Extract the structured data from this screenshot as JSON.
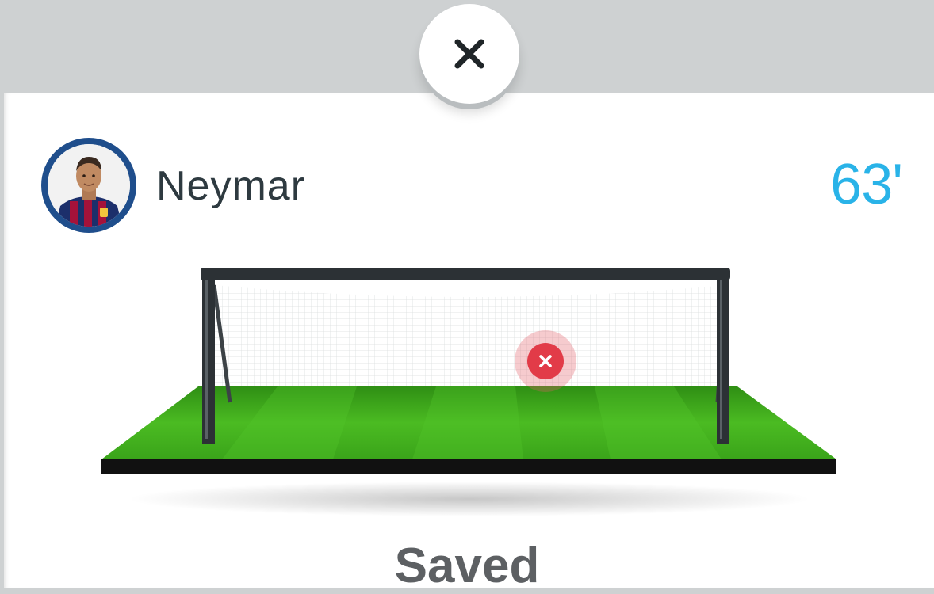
{
  "modal": {
    "close_icon": "close-x-icon"
  },
  "player": {
    "name": "Neymar",
    "avatar_icon": "player-avatar"
  },
  "event": {
    "minute": "63'",
    "result": "Saved",
    "shot_marker_icon": "saved-x-icon"
  },
  "colors": {
    "minute": "#29b3e8",
    "avatar_ring": "#1f4e8c",
    "shot_marker": "#e23b48",
    "result_text": "#5d6063",
    "grass": "#3fae1f"
  }
}
